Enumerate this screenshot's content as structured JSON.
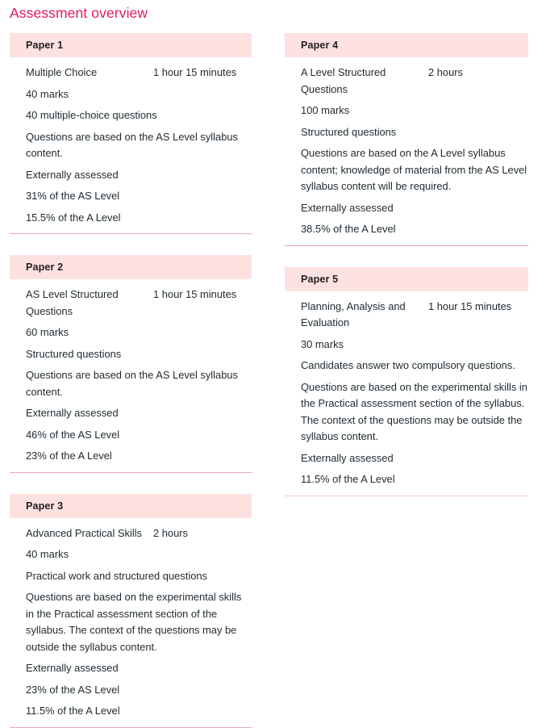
{
  "page": {
    "title": "Assessment overview",
    "accent_color": "#e5175e",
    "header_band_color": "#fde1e1",
    "rule_color": "#eaa7b4",
    "text_color": "#1f2a30"
  },
  "columns": {
    "left": [
      {
        "header": "Paper 1",
        "type": "Multiple Choice",
        "duration": "1 hour 15 minutes",
        "details": [
          "40 marks",
          "40 multiple-choice questions",
          "Questions are based on the AS Level syllabus content.",
          "Externally assessed",
          "31% of the AS Level",
          "15.5% of the A Level"
        ]
      },
      {
        "header": "Paper 2",
        "type": "AS Level Structured Questions",
        "duration": "1 hour 15 minutes",
        "details": [
          "60 marks",
          "Structured questions",
          "Questions are based on the AS Level syllabus content.",
          "Externally assessed",
          "46% of the AS Level",
          "23% of the A Level"
        ]
      },
      {
        "header": "Paper 3",
        "type": "Advanced Practical Skills",
        "duration": "2 hours",
        "details": [
          "40 marks",
          "Practical work and structured questions",
          "Questions are based on the experimental skills in the Practical assessment section of the syllabus. The context of the questions may be outside the syllabus content.",
          "Externally assessed",
          "23% of the AS Level",
          "11.5% of the A Level"
        ]
      }
    ],
    "right": [
      {
        "header": "Paper 4",
        "type": "A Level Structured Questions",
        "duration": "2 hours",
        "details": [
          "100 marks",
          "Structured questions",
          "Questions are based on the A Level syllabus content; knowledge of material from the AS Level syllabus content will be required.",
          "Externally assessed",
          "38.5% of the A Level"
        ]
      },
      {
        "header": "Paper 5",
        "type": "Planning, Analysis and Evaluation",
        "duration": "1 hour 15 minutes",
        "details": [
          "30 marks",
          "Candidates answer two compulsory questions.",
          "Questions are based on the experimental skills in the Practical assessment section of the syllabus. The context of the questions may be outside the syllabus content.",
          "Externally assessed",
          "11.5% of the A Level"
        ]
      }
    ]
  }
}
